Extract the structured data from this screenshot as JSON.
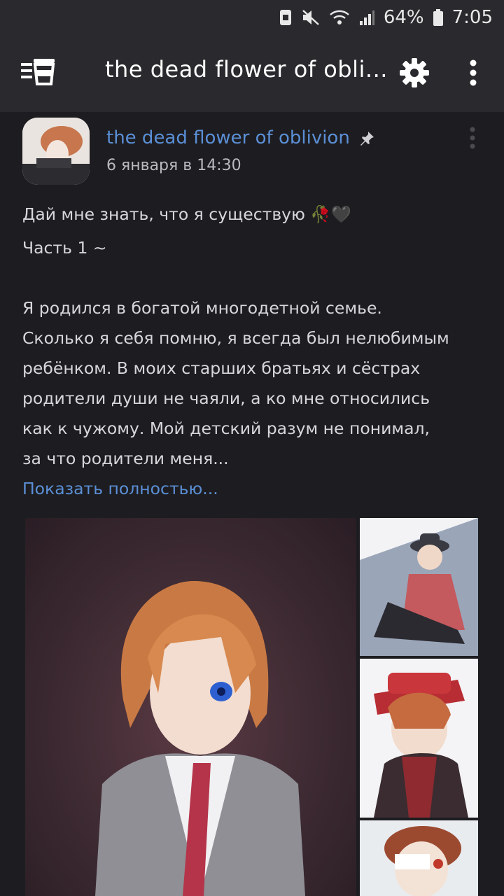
{
  "status_bar": {
    "battery_percent": "64%",
    "time": "7:05"
  },
  "app_bar": {
    "title": "the dead flower of obli..."
  },
  "post": {
    "author": "the dead flower of oblivion",
    "date": "6 января в 14:30",
    "lines": [
      "Дай мне знать, что я существую 🥀🖤",
      "Часть 1 ~",
      "Я родился в богатой многодетной семье.",
      "Сколько я себя помню, я всегда был нелюбимым",
      "ребёнком. В моих старших братьях и сёстрах",
      "родители души не чаяли, а ко мне относились",
      "как к чужому. Мой детский разум не понимал,",
      "за что родители меня..."
    ],
    "show_more": "Показать полностью..."
  },
  "colors": {
    "background": "#1d1d21",
    "bar": "#2a2a2e",
    "link": "#5b8fd6",
    "text": "#d6d6db"
  }
}
